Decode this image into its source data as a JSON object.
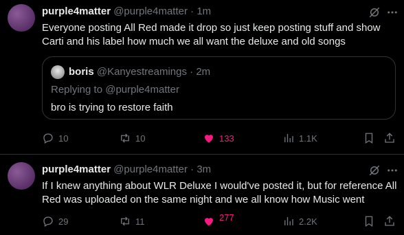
{
  "colors": {
    "background": "#000000",
    "text": "#e7e9ea",
    "muted": "#71767b",
    "like": "#f91880",
    "border": "#2f3336",
    "avatar": "#6b3a78"
  },
  "tweets": [
    {
      "display_name": "purple4matter",
      "handle": "@purple4matter",
      "time": "· 1m",
      "text": "Everyone posting All Red made it drop so just keep posting stuff and show Carti and his label how much we all want the deluxe and old songs",
      "quote": {
        "display_name": "boris",
        "handle": "@Kanyestreamings",
        "time": "· 2m",
        "replying_to": "Replying to @purple4matter",
        "text": "bro is trying to restore faith"
      },
      "actions": {
        "replies": "10",
        "retweets": "10",
        "likes": "133",
        "views": "1.1K"
      },
      "liked": true,
      "icons": [
        "grok-icon",
        "more-icon",
        "reply-icon",
        "retweet-icon",
        "heart-icon",
        "views-icon",
        "bookmark-icon",
        "share-icon"
      ]
    },
    {
      "display_name": "purple4matter",
      "handle": "@purple4matter",
      "time": "· 3m",
      "text": "If I knew anything about WLR Deluxe I would've posted it, but for reference All Red was uploaded on the same night and we all know how Music went",
      "actions": {
        "replies": "29",
        "retweets": "11",
        "likes": "277",
        "views": "2.2K"
      },
      "liked": true
    }
  ]
}
